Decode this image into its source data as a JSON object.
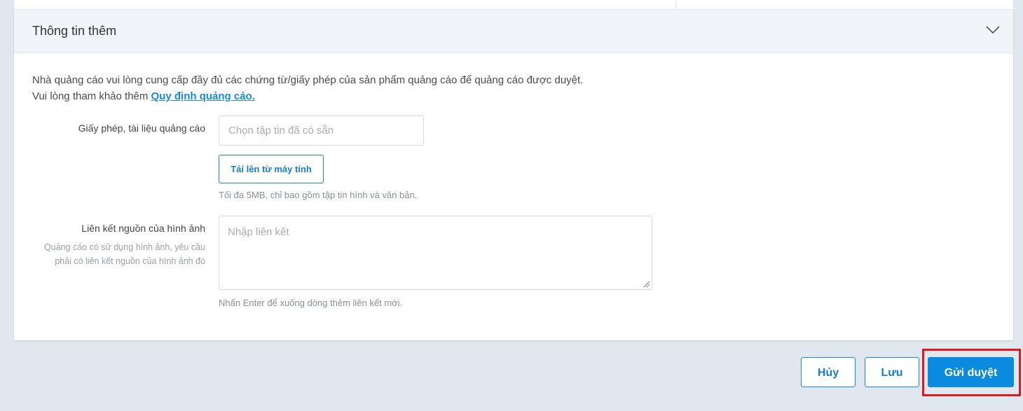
{
  "section": {
    "title": "Thông tin thêm"
  },
  "notice": {
    "line1": "Nhà quảng cáo vui lòng cung cấp đầy đủ các chứng từ/giấy phép của sản phẩm quảng cáo để quảng cáo được duyệt.",
    "line2_prefix": "Vui lòng tham khảo thêm ",
    "line2_link": "Quy định quảng cáo."
  },
  "license_field": {
    "label": "Giấy phép, tài liệu quảng cáo",
    "placeholder": "Chọn tập tin đã có sẵn",
    "upload_button": "Tải lên từ máy tính",
    "hint": "Tối đa 5MB, chỉ bao gồm tập tin hình và văn bản."
  },
  "image_source_field": {
    "label": "Liên kết nguồn của hình ảnh",
    "help": "Quảng cáo có sử dụng hình ảnh, yêu cầu phải có liên kết nguồn của hình ảnh đó",
    "placeholder": "Nhập liên kết",
    "hint": "Nhấn Enter để xuống dòng thêm liên kết mới."
  },
  "actions": {
    "cancel": "Hủy",
    "save": "Lưu",
    "submit": "Gửi duyệt"
  },
  "icons": {
    "collapse": "chevron-down-icon",
    "resize": "resize-handle-icon"
  },
  "colors": {
    "accent": "#0b8be0",
    "highlight": "#e0181f",
    "background": "#e1e7ef"
  }
}
